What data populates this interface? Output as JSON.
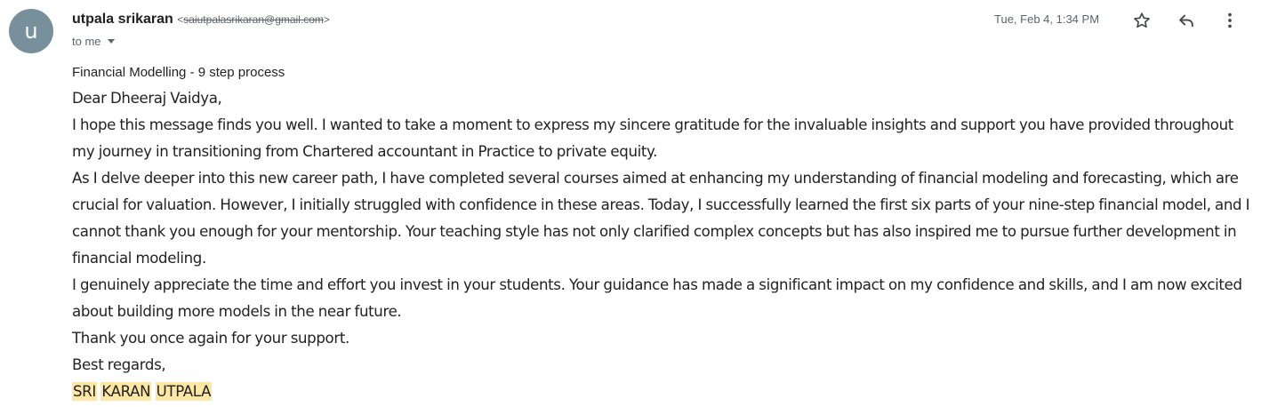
{
  "sender": {
    "avatar_letter": "u",
    "name": "utpala srikaran",
    "email": "saiutpalasrikaran@gmail.com",
    "email_open": "<",
    "email_close": ">"
  },
  "recipient": {
    "to_label": "to me"
  },
  "timestamp": "Tue, Feb 4, 1:34 PM",
  "subject": "Financial Modelling - 9 step process",
  "body": {
    "greeting": "Dear Dheeraj Vaidya,",
    "paragraphs": [
      "I hope this message finds you well. I wanted to take a moment to express my sincere gratitude for the invaluable insights and support you have provided throughout my journey in transitioning from Chartered accountant in Practice to private equity.",
      "As I delve deeper into this new career path, I have completed several courses aimed at enhancing my understanding of financial modeling and forecasting, which are crucial for valuation. However, I initially struggled with confidence in these areas. Today, I successfully learned the first six parts of your nine-step financial model, and I cannot thank you enough for your mentorship. Your teaching style has not only clarified complex concepts but has also inspired me to pursue further development in financial modeling.",
      "I genuinely appreciate the time and effort you invest in your students. Your guidance has made a significant impact on my confidence and skills, and I am now excited about building more models in the near future.",
      "Thank you once again for your support."
    ],
    "closing": "Best regards,",
    "signature": [
      "SRI",
      "KARAN",
      "UTPALA"
    ]
  },
  "icons": {
    "star": "star-icon",
    "reply": "reply-icon",
    "more": "more-vert-icon",
    "caret": "chevron-down-icon"
  },
  "colors": {
    "avatar_bg": "#78909c",
    "signature_highlight": "#fce8a4",
    "meta_text": "#5f6368"
  }
}
